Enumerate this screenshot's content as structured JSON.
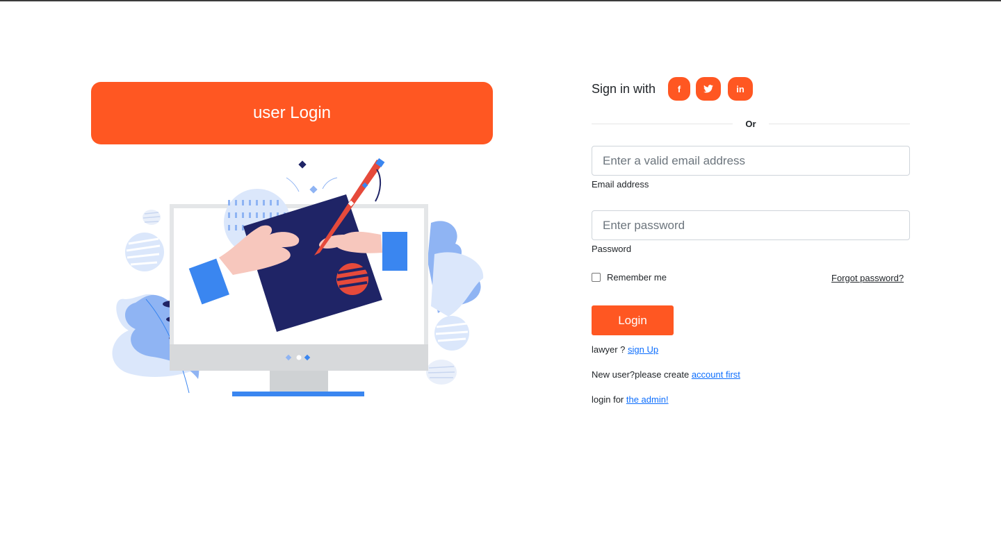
{
  "banner": {
    "title": "user Login"
  },
  "signin": {
    "label": "Sign in with",
    "social": [
      {
        "name": "facebook",
        "glyph": "f"
      },
      {
        "name": "twitter",
        "glyph": "t"
      },
      {
        "name": "linkedin",
        "glyph": "in"
      }
    ]
  },
  "divider": {
    "text": "Or"
  },
  "email": {
    "placeholder": "Enter a valid email address",
    "value": "",
    "label": "Email address"
  },
  "password": {
    "placeholder": "Enter password",
    "value": "",
    "label": "Password"
  },
  "remember": {
    "label": "Remember me",
    "checked": false
  },
  "forgot": {
    "text": "Forgot password?"
  },
  "login_button": {
    "label": "Login"
  },
  "links": {
    "lawyer": {
      "prefix": "lawyer ? ",
      "link": "sign Up"
    },
    "new_user": {
      "prefix": "New user?please create ",
      "link": "account first"
    },
    "admin": {
      "prefix": "login for ",
      "link": "the admin!"
    }
  },
  "colors": {
    "accent": "#ff5722",
    "link": "#0d6efd",
    "navy": "#1f2466",
    "blue": "#3a86f0"
  }
}
